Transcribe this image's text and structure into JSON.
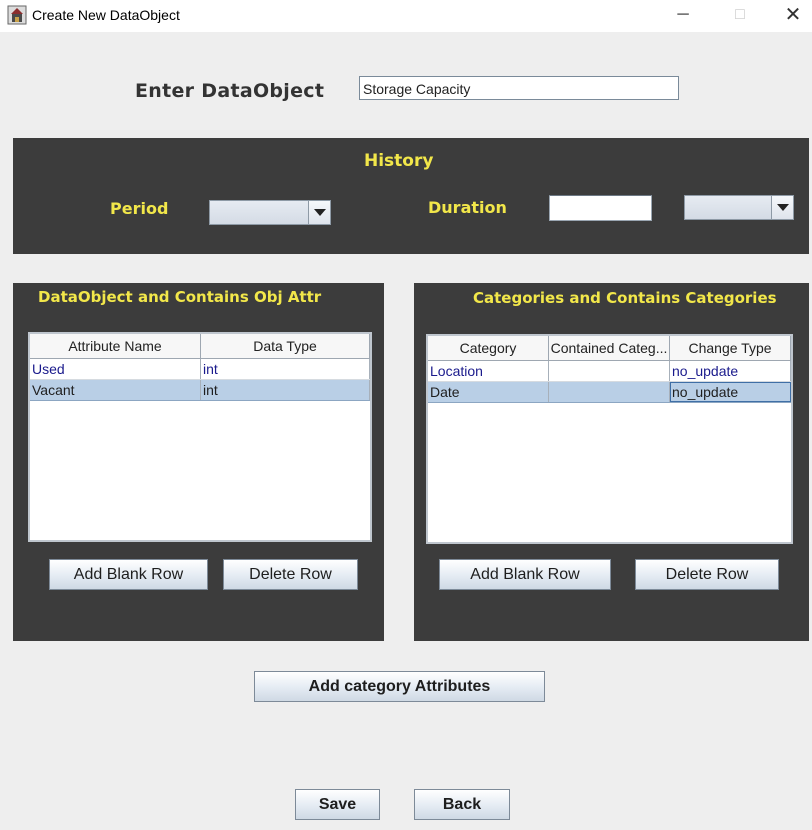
{
  "window": {
    "title": "Create New DataObject",
    "minimize": "─",
    "maximize": "□",
    "close": "✕"
  },
  "form": {
    "enter_label": "Enter DataObject",
    "dataobject_value": "Storage Capacity"
  },
  "history": {
    "title": "History",
    "period_label": "Period",
    "period_value": "",
    "duration_label": "Duration",
    "duration_value": "",
    "duration_unit_value": ""
  },
  "left_panel": {
    "title": "DataObject and Contains Obj Attr",
    "columns": [
      "Attribute Name",
      "Data Type"
    ],
    "rows": [
      {
        "cells": [
          "Used",
          "int"
        ],
        "selected": false
      },
      {
        "cells": [
          "Vacant",
          "int"
        ],
        "selected": true
      }
    ],
    "add_blank_row": "Add Blank Row",
    "delete_row": "Delete Row"
  },
  "right_panel": {
    "title": "Categories and Contains Categories",
    "columns": [
      "Category",
      "Contained Categ...",
      "Change Type"
    ],
    "rows": [
      {
        "cells": [
          "Location",
          "",
          "no_update"
        ],
        "selected": false
      },
      {
        "cells": [
          "Date",
          "",
          "no_update"
        ],
        "selected": true
      }
    ],
    "add_blank_row": "Add Blank Row",
    "delete_row": "Delete Row"
  },
  "buttons": {
    "add_category_attributes": "Add category Attributes",
    "save": "Save",
    "back": "Back"
  },
  "colors": {
    "panel_background": "#3c3c3c",
    "panel_title": "#f2e74a",
    "selected_row": "#b9cfe6",
    "cell_text": "#1a1a8c"
  },
  "icons": [
    "app-icon",
    "minimize-icon",
    "maximize-icon",
    "close-icon",
    "chevron-down-icon"
  ]
}
